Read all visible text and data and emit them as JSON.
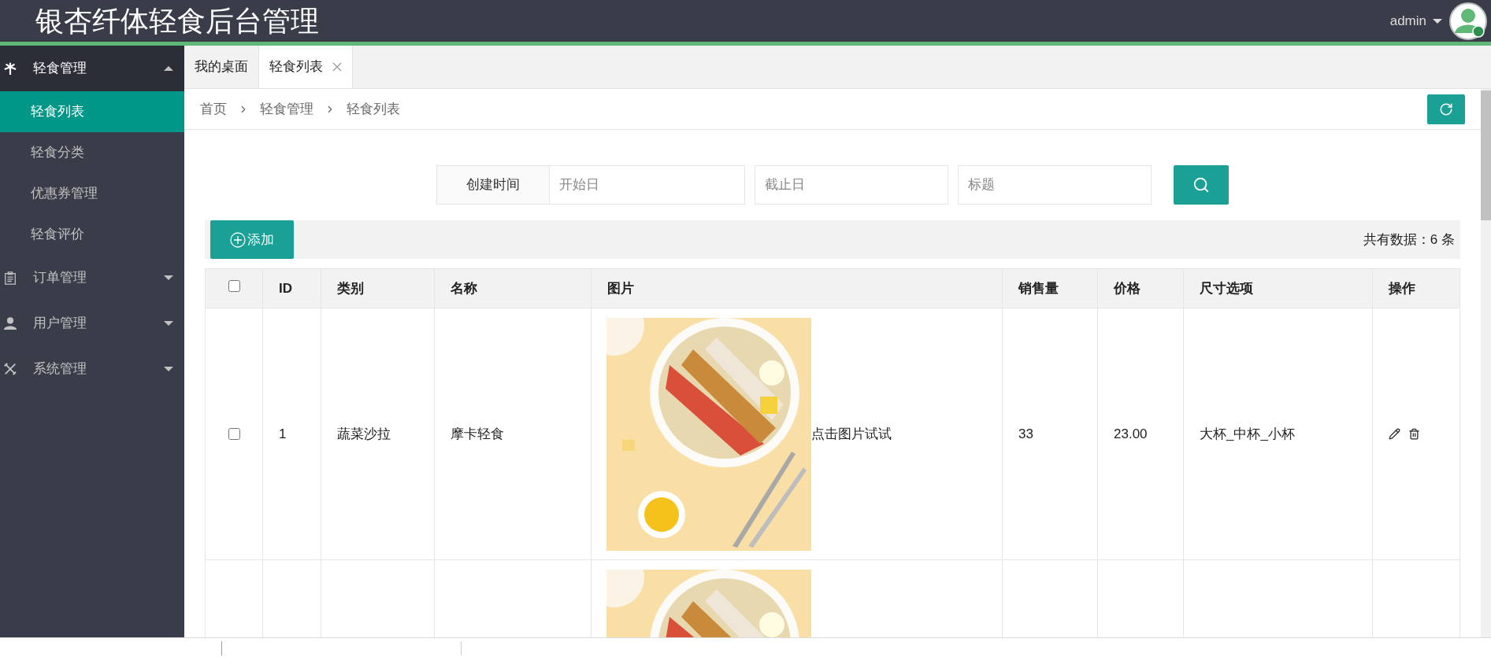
{
  "header": {
    "title": "银杏纤体轻食后台管理",
    "user": "admin"
  },
  "sidebar": {
    "items": [
      {
        "label": "轻食管理",
        "expanded": true,
        "children": [
          {
            "label": "轻食列表",
            "selected": true
          },
          {
            "label": "轻食分类",
            "selected": false
          },
          {
            "label": "优惠券管理",
            "selected": false
          },
          {
            "label": "轻食评价",
            "selected": false
          }
        ]
      },
      {
        "label": "订单管理",
        "expanded": false
      },
      {
        "label": "用户管理",
        "expanded": false
      },
      {
        "label": "系统管理",
        "expanded": false
      }
    ]
  },
  "tabs": [
    {
      "label": "我的桌面",
      "selected": false
    },
    {
      "label": "轻食列表",
      "selected": true
    }
  ],
  "breadcrumb": [
    "首页",
    "轻食管理",
    "轻食列表"
  ],
  "filter": {
    "label": "创建时间",
    "fields": [
      {
        "placeholder": "开始日"
      },
      {
        "placeholder": "截止日"
      },
      {
        "placeholder": "标题"
      }
    ]
  },
  "toolbar": {
    "add_button": "添加",
    "total": "共有数据：6 条"
  },
  "table": {
    "columns": [
      "ID",
      "类别",
      "名称",
      "图片",
      "销售量",
      "价格",
      "尺寸选项",
      "操作"
    ],
    "header_checked": false,
    "rows": [
      {
        "kind": "full",
        "selected": false,
        "id": "1",
        "category": "蔬菜沙拉",
        "name": "摩卡轻食",
        "picture_hint": "点击图片试试",
        "sales": "33",
        "price": "23.00",
        "sizes": "大杯_中杯_小杯"
      },
      {
        "kind": "cut"
      }
    ]
  }
}
